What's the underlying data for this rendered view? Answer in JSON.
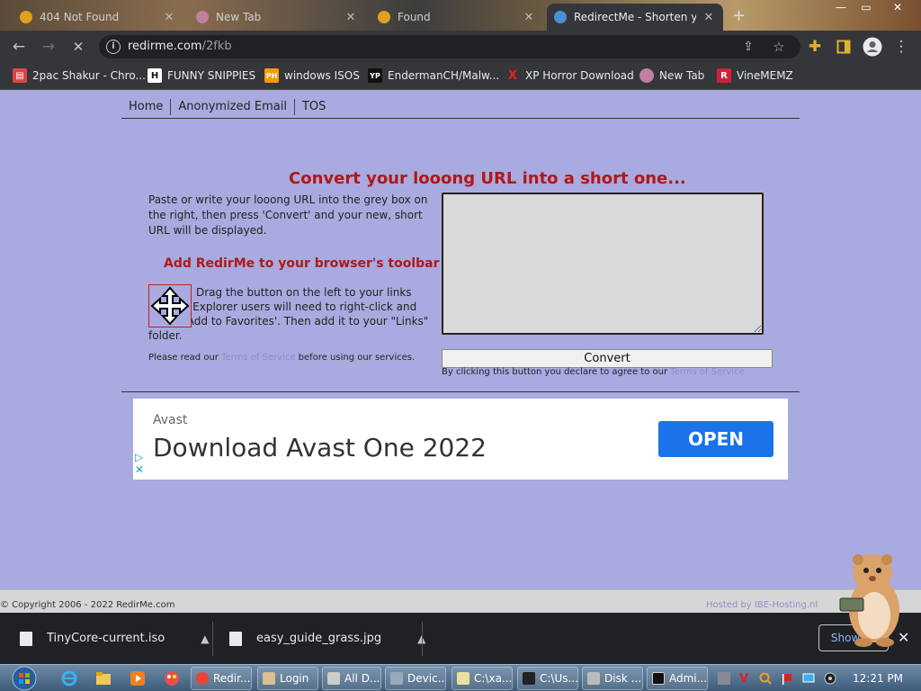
{
  "browser": {
    "tabs": [
      {
        "label": "404 Not Found"
      },
      {
        "label": "New Tab"
      },
      {
        "label": "Found"
      },
      {
        "label": "RedirectMe - Shorten yo"
      }
    ],
    "url_host": "redirme.com",
    "url_path": "/2fkb",
    "bookmarks": [
      {
        "label": "2pac Shakur - Chro...",
        "icon": "store-icon"
      },
      {
        "label": "FUNNY SNIPPIES",
        "icon": "h-icon",
        "glyph": "H"
      },
      {
        "label": "windows ISOS",
        "icon": "ph-icon",
        "glyph": "PH"
      },
      {
        "label": "EndermanCH/Malw...",
        "icon": "yp-icon",
        "glyph": "YP"
      },
      {
        "label": "XP Horror Download",
        "icon": "x-icon",
        "glyph": "X"
      },
      {
        "label": "New Tab",
        "icon": "globe-icon"
      },
      {
        "label": "VineMEMZ",
        "icon": "r-icon",
        "glyph": "R"
      }
    ]
  },
  "site": {
    "nav": [
      "Home",
      "Anonymized Email",
      "TOS"
    ],
    "headline": "Convert your looong URL into a short one...",
    "intro": "Paste or write your looong URL into the grey box on the right, then press 'Convert' and your new, short URL will be displayed.",
    "add_title": "Add RedirMe to your browser's toolbar",
    "drag_text": "Drag the button on the left to your links toolbar. Explorer users will need to right-click and select 'Add to Favorites'. Then add it to your \"Links\" folder.",
    "read_prefix": "Please read our ",
    "tos_link": "Terms of Service",
    "read_suffix": " before using our services.",
    "convert_label": "Convert",
    "declare_prefix": "By clicking this button you declare to agree to our ",
    "copyright": "© Copyright 2006 - 2022 RedirMe.com",
    "hosted": "Hosted by IBE-Hosting.nl"
  },
  "ad": {
    "brand": "Avast",
    "headline": "Download Avast One 2022",
    "cta": "OPEN"
  },
  "downloads": {
    "items": [
      "TinyCore-current.iso",
      "easy_guide_grass.jpg"
    ],
    "show_all": "Show all"
  },
  "taskbar": {
    "tasks": [
      "Redir...",
      "Login",
      "All D...",
      "Devic...",
      "C:\\xa...",
      "C:\\Us...",
      "Disk ...",
      "Admi..."
    ],
    "clock": "12:21 PM"
  },
  "colors": {
    "page_bg": "#a9aadf",
    "headline": "#b01818",
    "ad_button": "#1a73e8"
  }
}
